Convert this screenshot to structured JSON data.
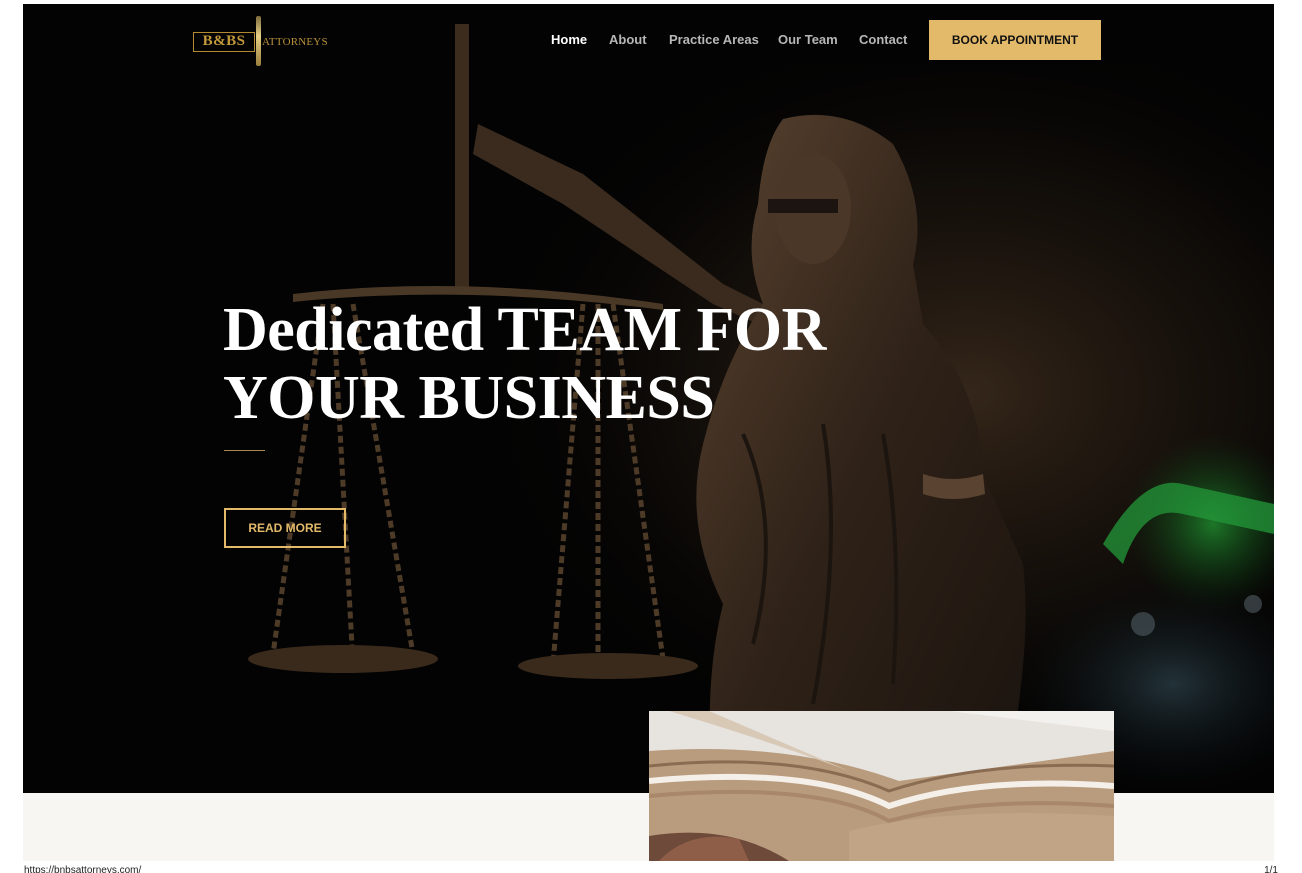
{
  "brand": {
    "logo_mark": "B&BS",
    "logo_text": "ATTORNEYS",
    "gold": "#e3ba6a"
  },
  "nav": {
    "items": [
      "Home",
      "About",
      "Practice Areas",
      "Our Team",
      "Contact"
    ],
    "active": "Home",
    "cta_label": "BOOK APPOINTMENT"
  },
  "hero": {
    "title_line1": "Dedicated TEAM FOR",
    "title_line2": "YOUR BUSINESS",
    "button_label": "READ MORE"
  },
  "print_footer": {
    "url": "https://bnbsattorneys.com/",
    "page": "1/1"
  }
}
